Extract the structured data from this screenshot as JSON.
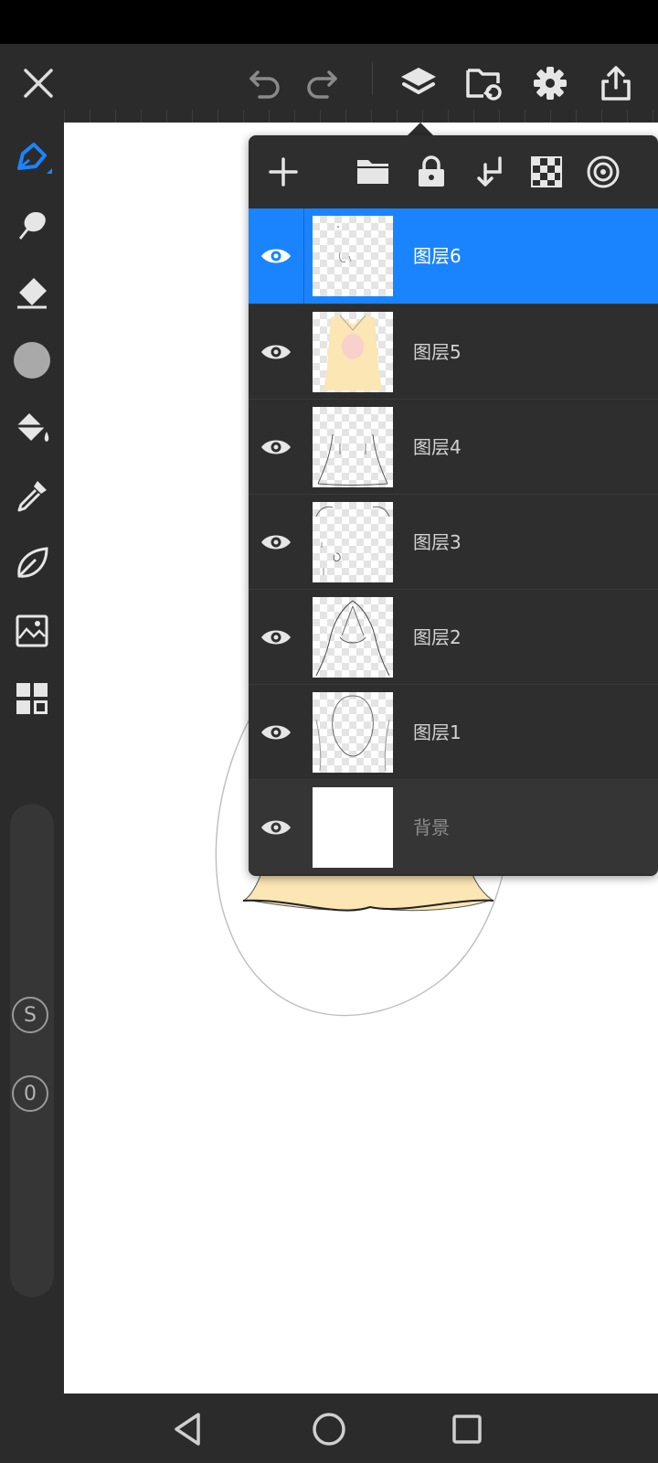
{
  "toolbar": {
    "close_icon": "close-icon",
    "undo_icon": "undo-icon",
    "redo_icon": "redo-icon",
    "layers_icon": "layers-icon",
    "gallery_icon": "gallery-sync-icon",
    "settings_icon": "gear-icon",
    "share_icon": "share-icon"
  },
  "tools": [
    "pen-icon",
    "smudge-icon",
    "eraser-icon",
    "color-icon",
    "fill-bucket-icon",
    "eyedropper-icon",
    "leaf-icon",
    "image-import-icon",
    "grid-icon"
  ],
  "quick_buttons": {
    "s_label": "S",
    "zero_label": "0"
  },
  "layers_panel": {
    "toolbar_icons": [
      "add-icon",
      "folder-icon",
      "lock-icon",
      "merge-down-icon",
      "transparency-icon",
      "target-icon"
    ],
    "layers": [
      {
        "name": "图层6",
        "visible": true,
        "selected": true
      },
      {
        "name": "图层5",
        "visible": true,
        "selected": false
      },
      {
        "name": "图层4",
        "visible": true,
        "selected": false
      },
      {
        "name": "图层3",
        "visible": true,
        "selected": false
      },
      {
        "name": "图层2",
        "visible": true,
        "selected": false
      },
      {
        "name": "图层1",
        "visible": true,
        "selected": false
      },
      {
        "name": "背景",
        "visible": true,
        "selected": false
      }
    ]
  },
  "colors": {
    "accent": "#1a84ff",
    "panel": "#2e2e2e",
    "fill_skin": "#fbe6b4"
  },
  "navbar": {
    "back_icon": "back-icon",
    "home_icon": "home-icon",
    "recents_icon": "recents-icon"
  }
}
